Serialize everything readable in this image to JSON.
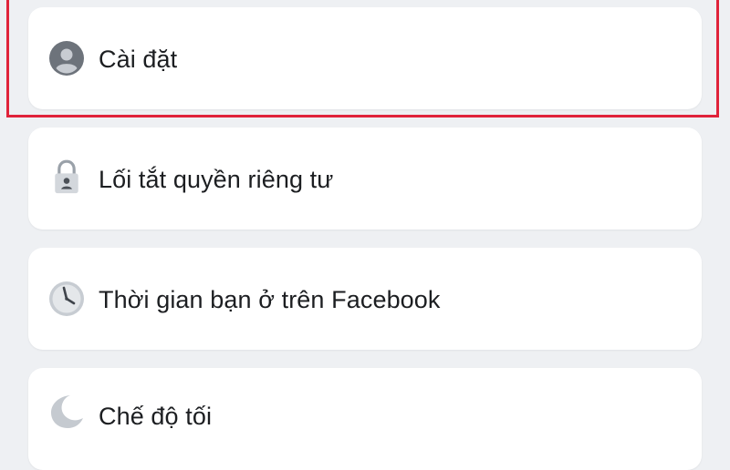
{
  "colors": {
    "background": "#eef0f3",
    "card": "#ffffff",
    "text": "#1c1e21",
    "highlight": "#e0233a",
    "icon_gray": "#70757c",
    "icon_circle": "#c9cdd3"
  },
  "menu": {
    "items": [
      {
        "label": "Cài đặt",
        "icon": "user-circle-icon",
        "highlighted": true
      },
      {
        "label": "Lối tắt quyền riêng tư",
        "icon": "lock-icon",
        "highlighted": false
      },
      {
        "label": "Thời gian bạn ở trên Facebook",
        "icon": "clock-icon",
        "highlighted": false
      },
      {
        "label": "Chế độ tối",
        "icon": "moon-icon",
        "highlighted": false
      }
    ]
  }
}
